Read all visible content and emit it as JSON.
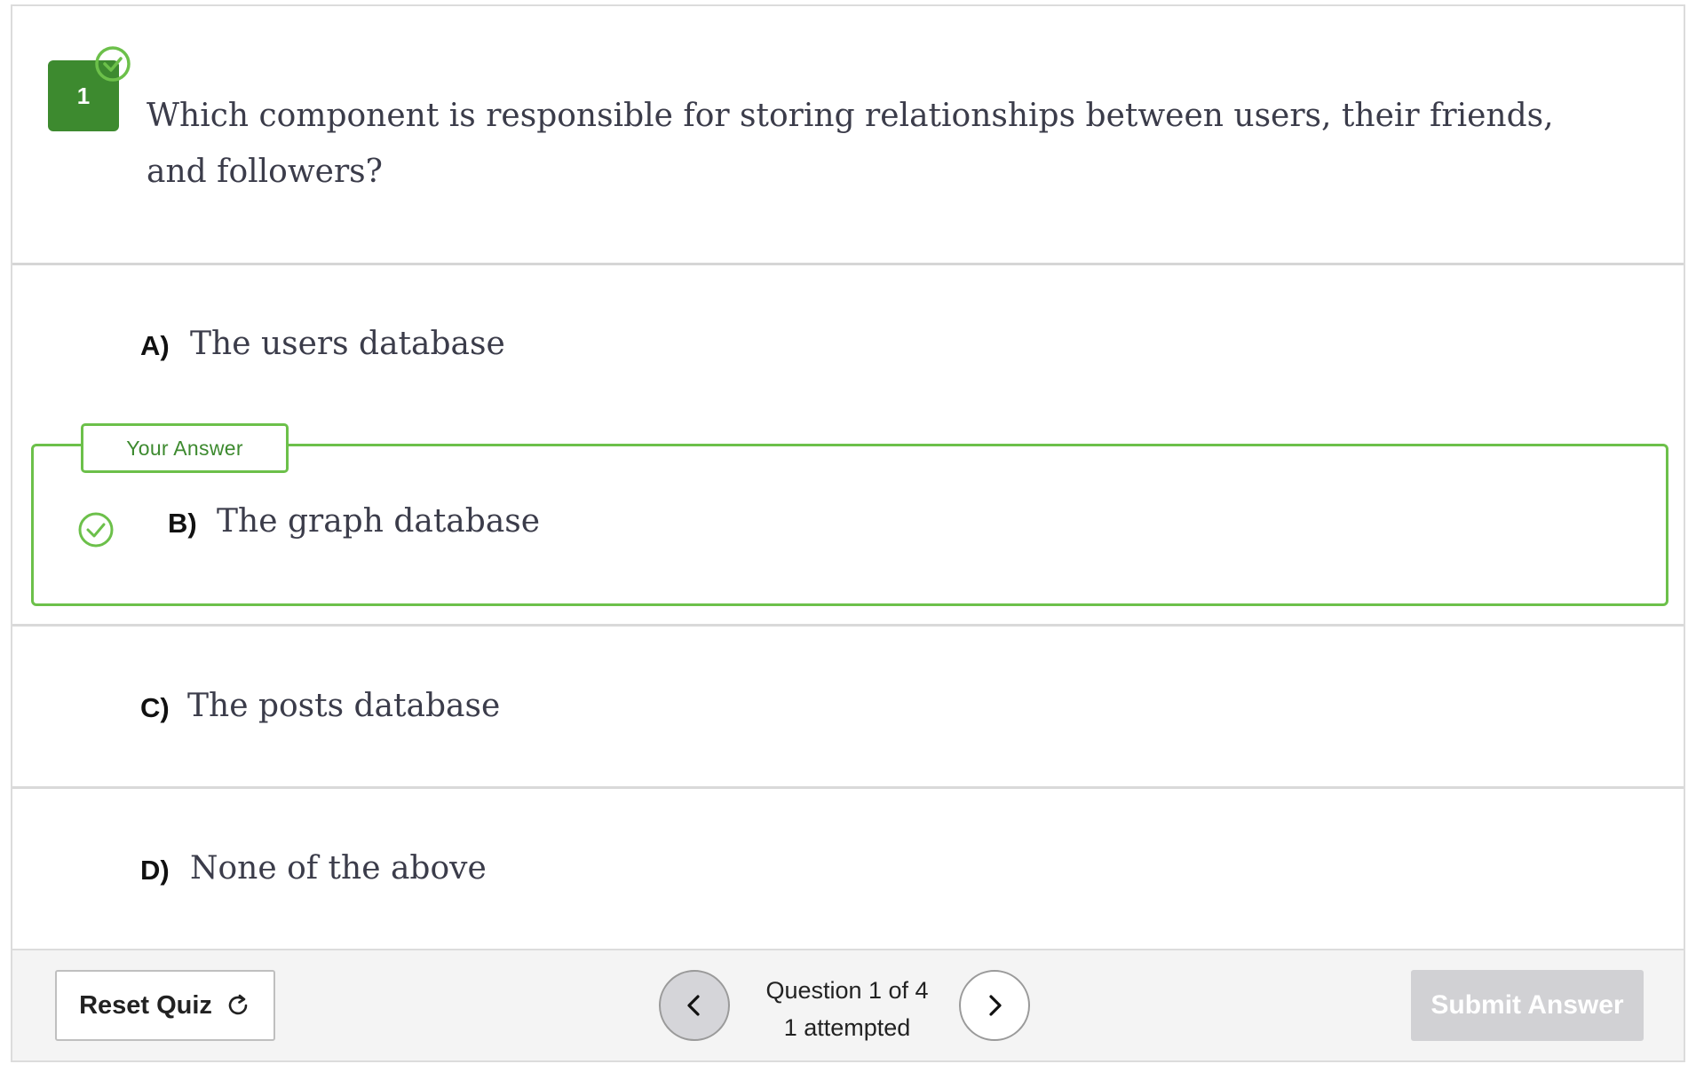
{
  "question": {
    "number": "1",
    "text": "Which component is responsible for storing relationships between users, their friends, and followers?"
  },
  "options": [
    {
      "letter": "A)",
      "text": "The users database"
    },
    {
      "letter": "B)",
      "text": "The graph database"
    },
    {
      "letter": "C)",
      "text": "The posts database"
    },
    {
      "letter": "D)",
      "text": "None of the above"
    }
  ],
  "answer": {
    "tag": "Your Answer",
    "selected_letter": "B)",
    "status": "correct"
  },
  "footer": {
    "reset_label": "Reset Quiz",
    "progress": "Question 1 of 4",
    "attempted": "1 attempted",
    "submit_label": "Submit Answer"
  },
  "colors": {
    "accent_green": "#6cc04a",
    "badge_green": "#3d8a2f",
    "submit_disabled": "#d1d1d4"
  },
  "icons": {
    "question_status": "check-circle-icon",
    "answer_status": "check-circle-icon",
    "reset": "refresh-icon",
    "prev": "chevron-left-icon",
    "next": "chevron-right-icon"
  }
}
